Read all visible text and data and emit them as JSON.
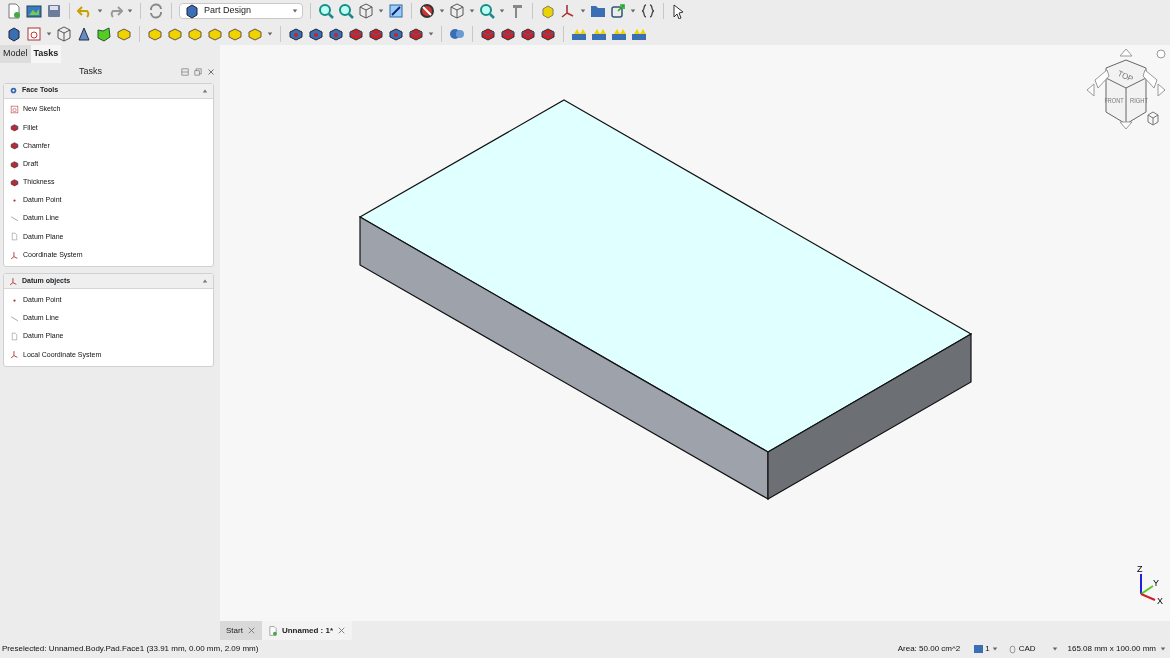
{
  "toolbar": {
    "workbench": "Part Design"
  },
  "panel_tabs": [
    {
      "label": "Model",
      "selected": false
    },
    {
      "label": "Tasks",
      "selected": true
    }
  ],
  "panel": {
    "title": "Tasks"
  },
  "sections": [
    {
      "title": "Face Tools",
      "expanded": true,
      "items": [
        {
          "label": "New Sketch",
          "kind": "sketch"
        },
        {
          "label": "Fillet",
          "kind": "solid"
        },
        {
          "label": "Chamfer",
          "kind": "solid"
        },
        {
          "label": "Draft",
          "kind": "solid"
        },
        {
          "label": "Thickness",
          "kind": "solid"
        },
        {
          "label": "Datum Point",
          "kind": "point"
        },
        {
          "label": "Datum Line",
          "kind": "line"
        },
        {
          "label": "Datum Plane",
          "kind": "plane"
        },
        {
          "label": "Coordinate System",
          "kind": "axes"
        }
      ]
    },
    {
      "title": "Datum objects",
      "expanded": true,
      "items": [
        {
          "label": "Datum Point",
          "kind": "point"
        },
        {
          "label": "Datum Line",
          "kind": "line"
        },
        {
          "label": "Datum Plane",
          "kind": "plane"
        },
        {
          "label": "Local Coordinate System",
          "kind": "axes"
        }
      ]
    }
  ],
  "navigation_cube": {
    "top": "TOP",
    "front": "FRONT",
    "right": "RIGHT"
  },
  "axes": {
    "x": "X",
    "y": "Y",
    "z": "Z"
  },
  "document_tabs": [
    {
      "label": "Start",
      "selected": false
    },
    {
      "label": "Unnamed : 1*",
      "selected": true
    }
  ],
  "status_bar": {
    "message": "Preselected: Unnamed.Body.Pad.Face1 (33.91 mm, 0.00 mm, 2.09 mm)",
    "area": "Area: 50.00 cm^2",
    "layer": "1",
    "nav_style": "CAD",
    "dimensions": "165.08 mm x 100.00 mm"
  }
}
